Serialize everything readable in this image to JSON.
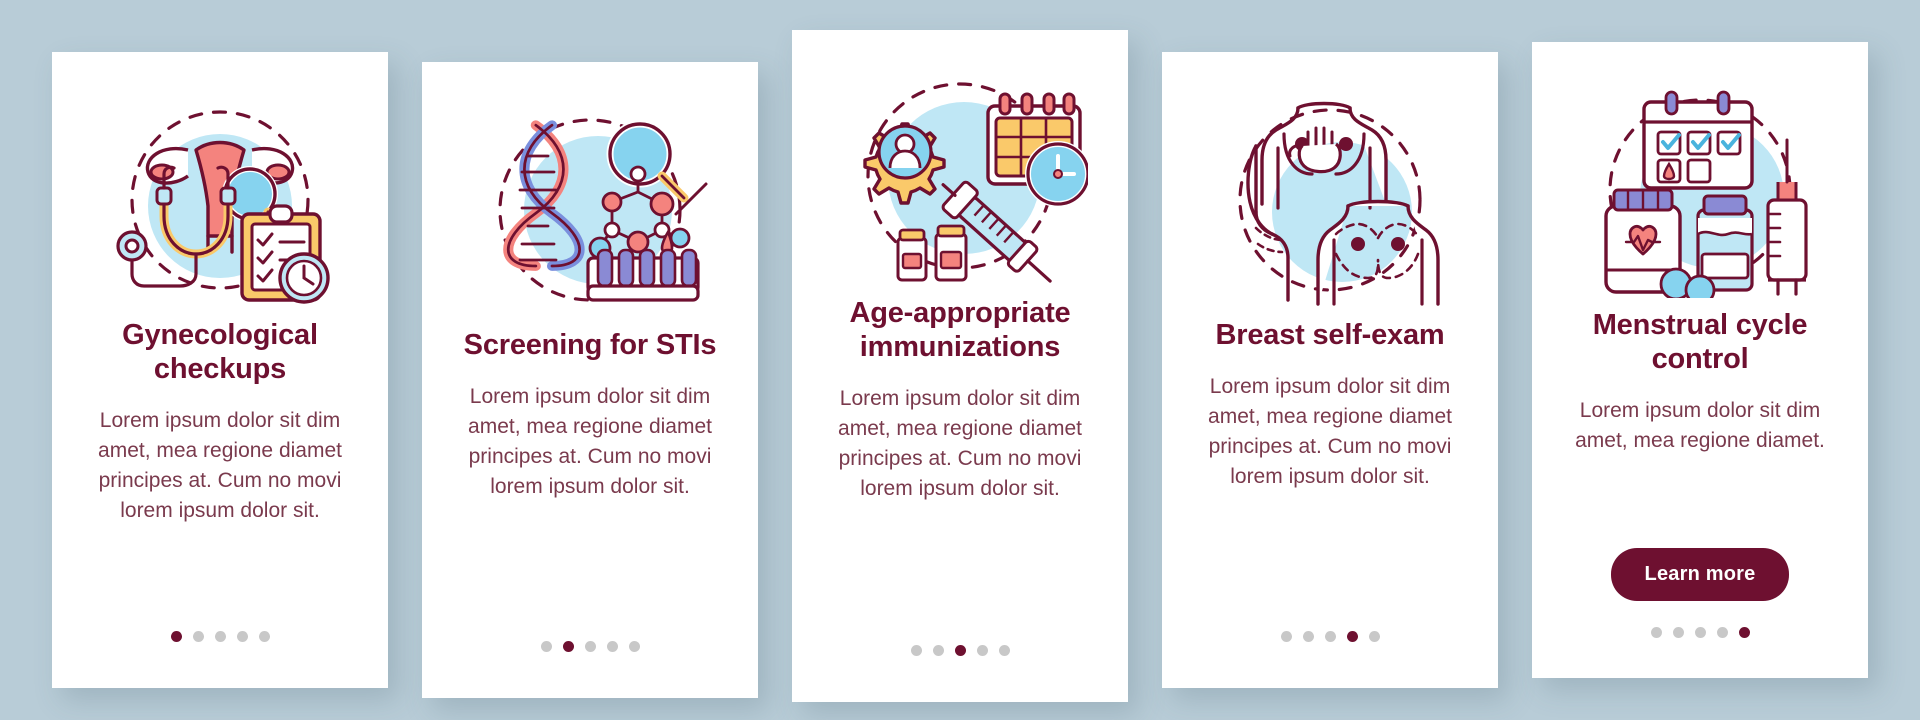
{
  "theme": {
    "background": "#b8ccd7",
    "card_background": "#ffffff",
    "accent": "#6e1030",
    "body_text": "#7a3a4d",
    "dot_inactive": "#c8c8c8",
    "illustration_blue": "#bfe7f5",
    "illustration_red": "#f4837e",
    "illustration_yellow": "#fac96a",
    "illustration_purple": "#8a8ad4"
  },
  "screens": [
    {
      "id": "gynecological-checkups",
      "icon": "uterus-stethoscope-clipboard-icon",
      "title": "Gynecological checkups",
      "body": "Lorem ipsum dolor sit dim amet, mea regione diamet principes at. Cum no movi lorem ipsum dolor sit.",
      "dots_total": 5,
      "dot_active": 1,
      "has_button": false,
      "button_label": ""
    },
    {
      "id": "screening-for-stis",
      "icon": "dna-magnifier-testtube-icon",
      "title": "Screening for STIs",
      "body": "Lorem ipsum dolor sit dim amet, mea regione diamet principes at. Cum no movi lorem ipsum dolor sit.",
      "dots_total": 5,
      "dot_active": 2,
      "has_button": false,
      "button_label": ""
    },
    {
      "id": "age-appropriate-immunizations",
      "icon": "calendar-syringe-vaccine-icon",
      "title": "Age-appropriate immunizations",
      "body": "Lorem ipsum dolor sit dim amet, mea regione diamet principes at. Cum no movi lorem ipsum dolor sit.",
      "dots_total": 5,
      "dot_active": 3,
      "has_button": false,
      "button_label": ""
    },
    {
      "id": "breast-self-exam",
      "icon": "breast-self-exam-icon",
      "title": "Breast self-exam",
      "body": "Lorem ipsum dolor sit dim amet, mea regione diamet principes at. Cum no movi lorem ipsum dolor sit.",
      "dots_total": 5,
      "dot_active": 4,
      "has_button": false,
      "button_label": ""
    },
    {
      "id": "menstrual-cycle-control",
      "icon": "calendar-pills-syringe-icon",
      "title": "Menstrual cycle control",
      "body": "Lorem ipsum dolor sit dim amet, mea regione diamet.",
      "dots_total": 5,
      "dot_active": 5,
      "has_button": true,
      "button_label": "Learn more"
    }
  ]
}
